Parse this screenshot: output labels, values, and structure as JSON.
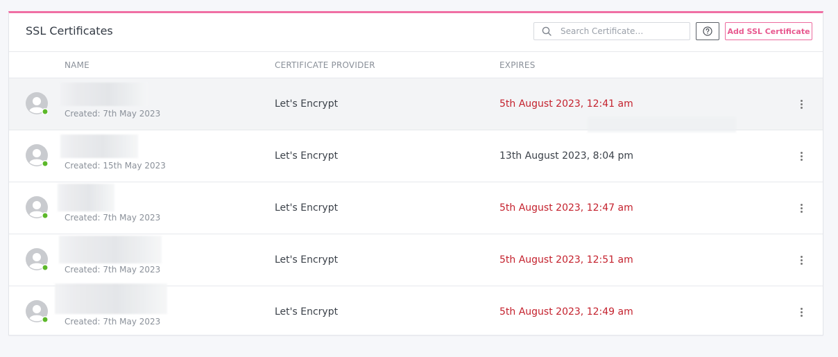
{
  "header": {
    "title": "SSL Certificates",
    "search_placeholder": "Search Certificate…",
    "help_icon": "question-circle-icon",
    "add_button": "Add SSL Certificate"
  },
  "columns": {
    "name": "NAME",
    "provider": "CERTIFICATE PROVIDER",
    "expires": "EXPIRES"
  },
  "colors": {
    "accent": "#f06fa4",
    "expired": "#c4212d",
    "status_online": "#5cb82a"
  },
  "rows": [
    {
      "created": "Created: 7th May 2023",
      "provider": "Let's Encrypt",
      "expires": "5th August 2023, 12:41 am",
      "expired": true
    },
    {
      "created": "Created: 15th May 2023",
      "provider": "Let's Encrypt",
      "expires": "13th August 2023, 8:04 pm",
      "expired": false
    },
    {
      "created": "Created: 7th May 2023",
      "provider": "Let's Encrypt",
      "expires": "5th August 2023, 12:47 am",
      "expired": true
    },
    {
      "created": "Created: 7th May 2023",
      "provider": "Let's Encrypt",
      "expires": "5th August 2023, 12:51 am",
      "expired": true
    },
    {
      "created": "Created: 7th May 2023",
      "provider": "Let's Encrypt",
      "expires": "5th August 2023, 12:49 am",
      "expired": true
    }
  ]
}
